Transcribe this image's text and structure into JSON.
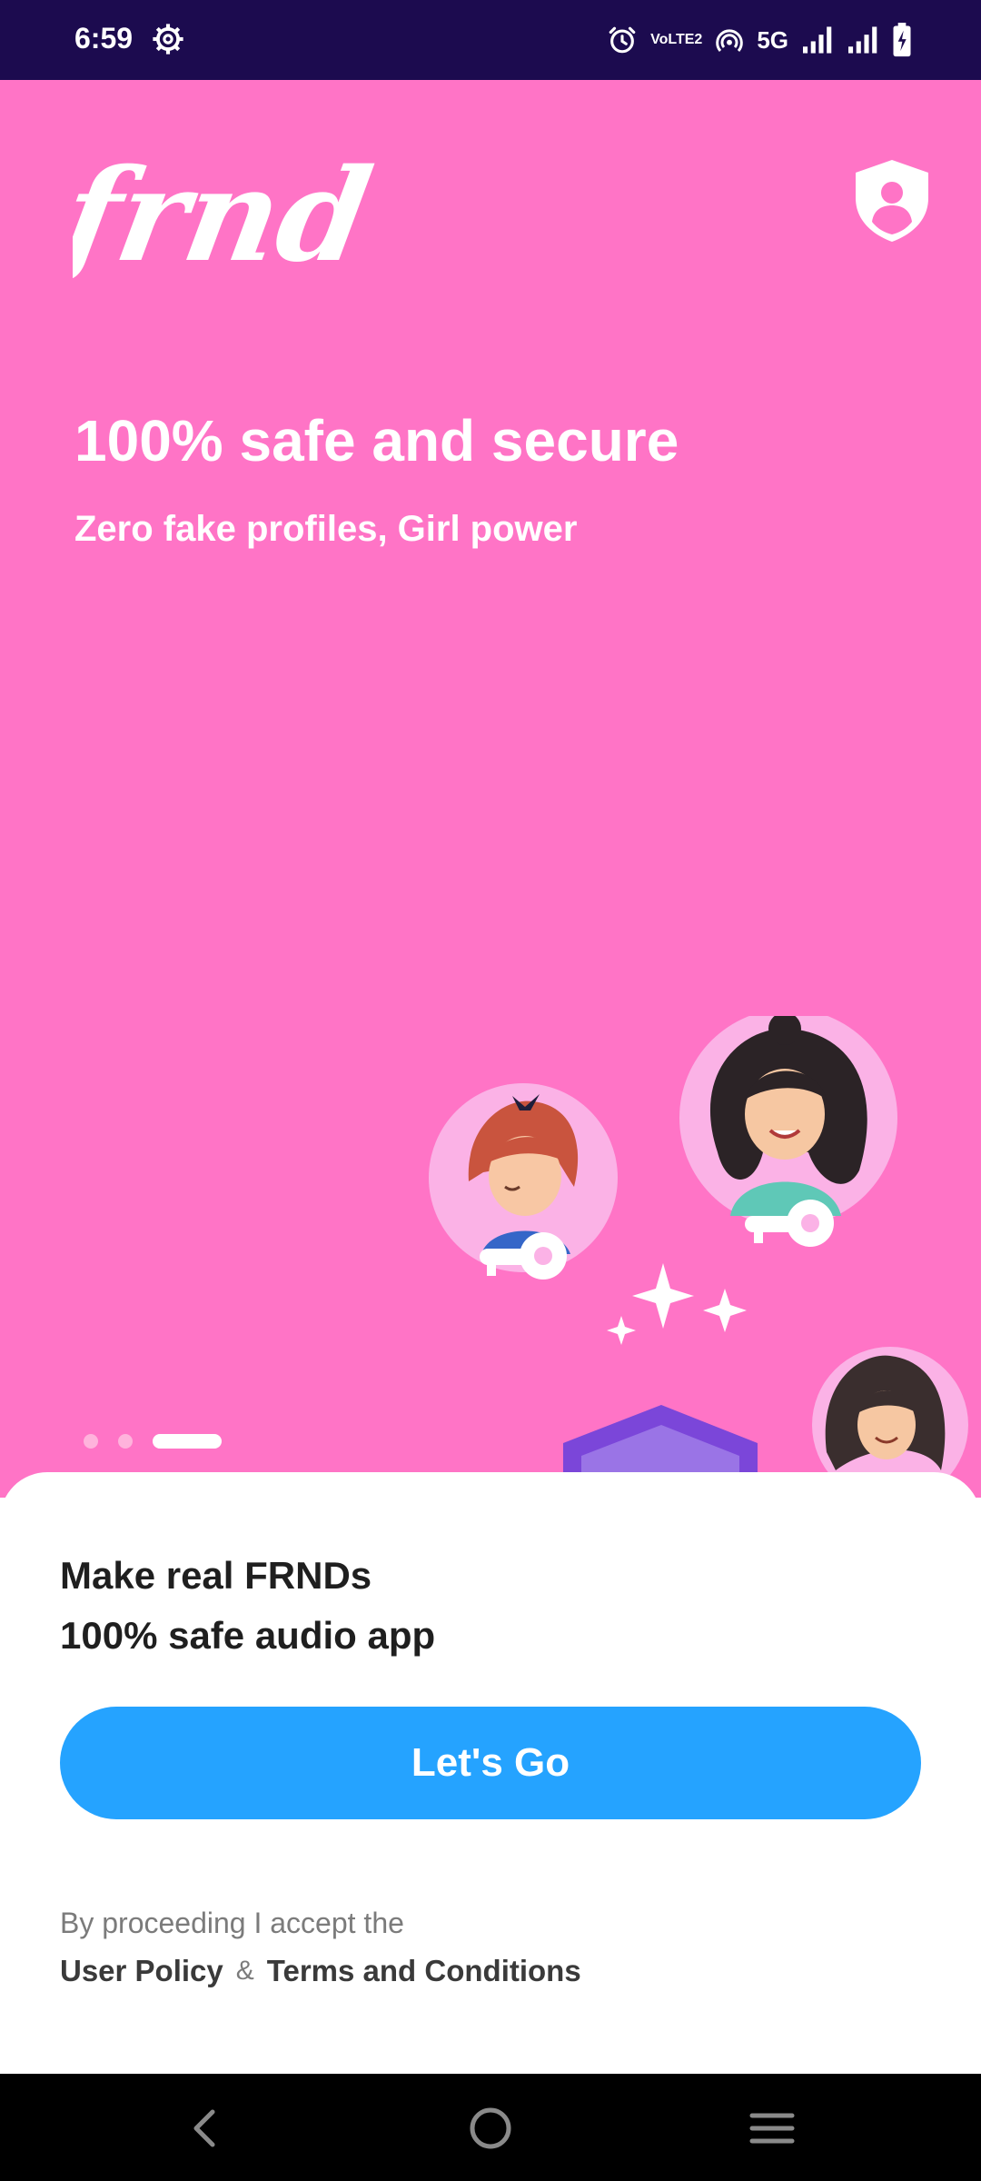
{
  "status_bar": {
    "time": "6:59",
    "network_label": "5G",
    "volte_label": "VoLTE2",
    "icons": [
      "settings-gear-icon",
      "alarm-icon",
      "volte-icon",
      "hotspot-icon",
      "signal-icon",
      "signal-icon",
      "battery-charging-icon"
    ]
  },
  "hero": {
    "logo_text": "frnd",
    "title": "100% safe and secure",
    "subtitle": "Zero fake profiles, Girl power",
    "background_color": "#ff74c6",
    "pager": {
      "total": 3,
      "active_index": 2
    }
  },
  "sheet": {
    "line1": "Make real FRNDs",
    "line2": "100% safe audio app",
    "cta_label": "Let's Go",
    "cta_color": "#25a3ff",
    "legal_prefix": "By proceeding I accept the",
    "user_policy_label": "User Policy",
    "ampersand": "&",
    "terms_label": "Terms and Conditions"
  },
  "nav_bar": {
    "icons": [
      "back-icon",
      "home-icon",
      "recents-menu-icon"
    ]
  }
}
